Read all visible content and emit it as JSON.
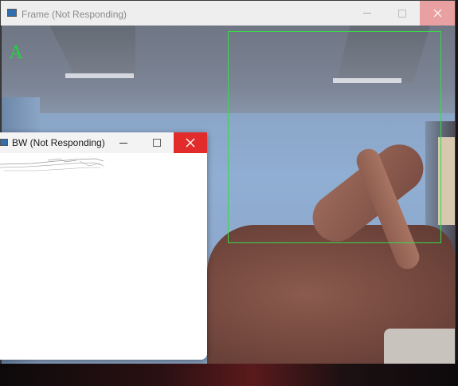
{
  "frame_window": {
    "title": "Frame (Not Responding)",
    "prediction_label": "A",
    "roi_color": "#39d84b",
    "label_color": "#22d33a"
  },
  "bw_window": {
    "title": "BW (Not Responding)",
    "close_color": "#e22b2b"
  },
  "icons": {
    "minimize": "minimize-icon",
    "maximize": "maximize-icon",
    "close": "close-icon",
    "app": "app-icon"
  }
}
